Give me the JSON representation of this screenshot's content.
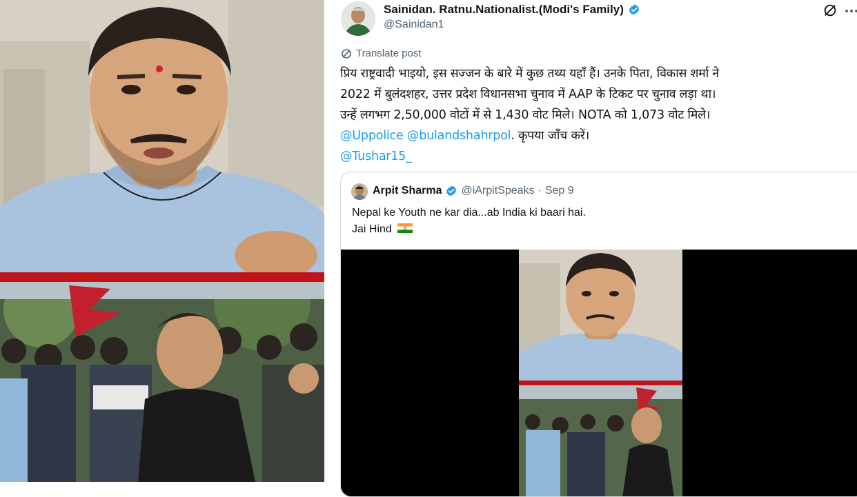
{
  "post": {
    "author_name": "Sainidan. Ratnu.Nationalist.(Modi's Family)",
    "author_handle": "@Sainidan1",
    "translate_label": "Translate post",
    "text_line1": "प्रिय राष्ट्रवादी भाइयो, इस सज्जन के बारे में कुछ तथ्य यहाँ हैं। उनके पिता, विकास शर्मा ने",
    "text_line2": "2022 में बुलंदशहर, उत्तर प्रदेश विधानसभा चुनाव में AAP के टिकट पर चुनाव लड़ा था।",
    "text_line3": "उन्हें लगभग 2,50,000 वोटों में से 1,430 वोट मिले। NOTA को 1,073 वोट मिले।",
    "mention1": "@Uppolice",
    "mention2": "@bulandshahrpol",
    "text_after_mentions": ". कृपया जाँच करें।",
    "mention3": "@Tushar15_"
  },
  "quote": {
    "author_name": "Arpit Sharma",
    "author_handle": "@iArpitSpeaks",
    "separator": "·",
    "date": "Sep 9",
    "text_line1": "Nepal ke Youth ne kar dia...ab India ki baari hai.",
    "text_line2": "Jai Hind"
  },
  "colors": {
    "link": "#1d9bf0",
    "verified": "#1d9bf0",
    "secondary_text": "#536471",
    "border": "#cfd9de",
    "red_band": "#c0141b"
  },
  "icons": [
    "verified-badge-icon",
    "grok-icon",
    "more-icon",
    "translate-icon",
    "india-flag-icon"
  ]
}
